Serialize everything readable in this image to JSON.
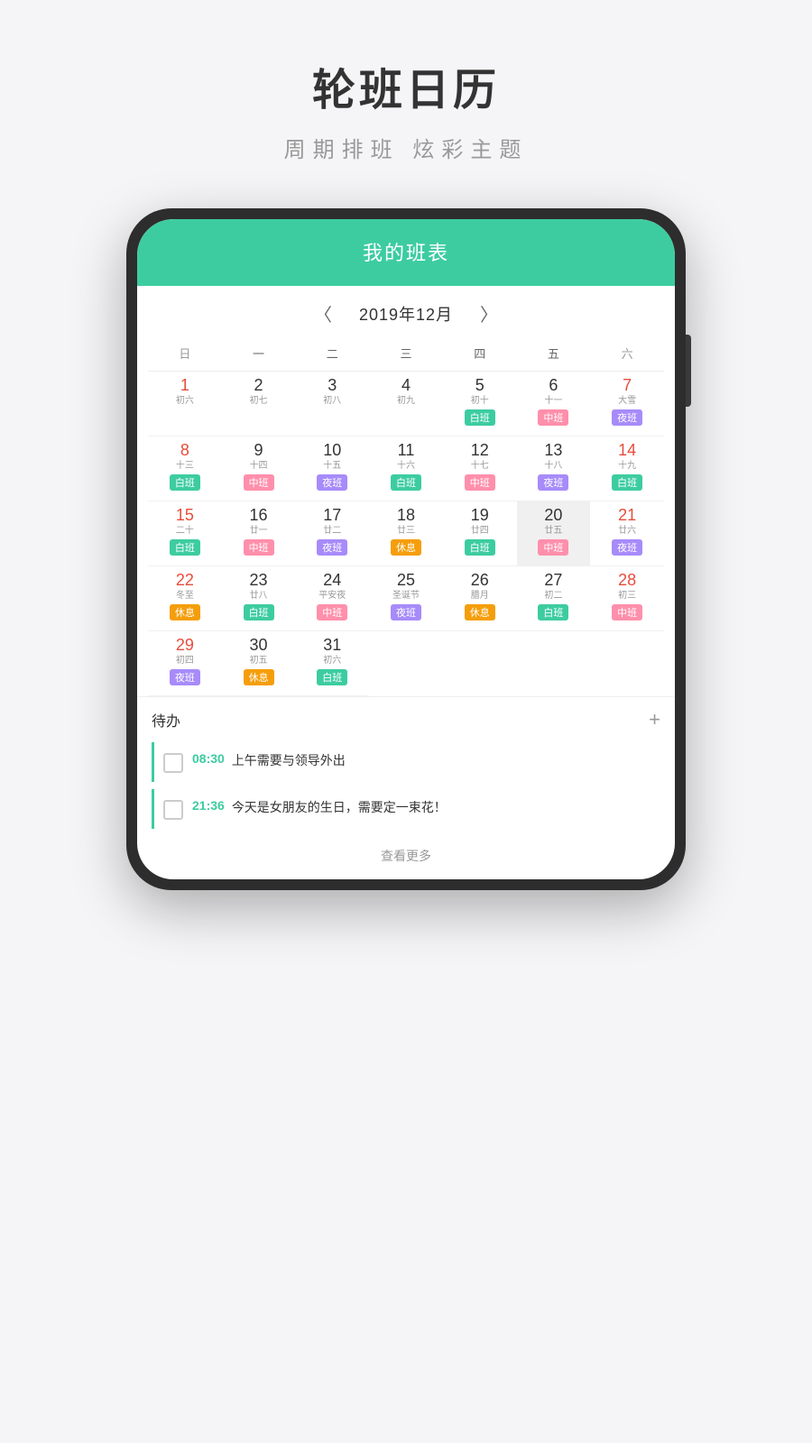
{
  "page": {
    "title": "轮班日历",
    "subtitle": "周期排班  炫彩主题"
  },
  "app": {
    "header_title": "我的班表"
  },
  "calendar": {
    "month_label": "2019年12月",
    "prev_arrow": "〈",
    "next_arrow": "〉",
    "weekdays": [
      "日",
      "一",
      "二",
      "三",
      "四",
      "五",
      "六"
    ],
    "days": [
      {
        "num": "1",
        "lunar": "初六",
        "shift": "",
        "shift_type": "",
        "red": true,
        "green": false,
        "empty": false,
        "today": false
      },
      {
        "num": "2",
        "lunar": "初七",
        "shift": "",
        "shift_type": "",
        "red": false,
        "green": false,
        "empty": false,
        "today": false
      },
      {
        "num": "3",
        "lunar": "初八",
        "shift": "",
        "shift_type": "",
        "red": false,
        "green": false,
        "empty": false,
        "today": false
      },
      {
        "num": "4",
        "lunar": "初九",
        "shift": "",
        "shift_type": "",
        "red": false,
        "green": false,
        "empty": false,
        "today": false
      },
      {
        "num": "5",
        "lunar": "初十",
        "shift": "白班",
        "shift_type": "white",
        "red": false,
        "green": false,
        "empty": false,
        "today": false
      },
      {
        "num": "6",
        "lunar": "十一",
        "shift": "中班",
        "shift_type": "mid",
        "red": false,
        "green": false,
        "empty": false,
        "today": false
      },
      {
        "num": "7",
        "lunar": "大雪",
        "shift": "夜班",
        "shift_type": "night",
        "red": true,
        "green": false,
        "empty": false,
        "today": false
      },
      {
        "num": "8",
        "lunar": "十三",
        "shift": "白班",
        "shift_type": "white",
        "red": true,
        "green": false,
        "empty": false,
        "today": false
      },
      {
        "num": "9",
        "lunar": "十四",
        "shift": "中班",
        "shift_type": "mid",
        "red": false,
        "green": false,
        "empty": false,
        "today": false
      },
      {
        "num": "10",
        "lunar": "十五",
        "shift": "夜班",
        "shift_type": "night",
        "red": false,
        "green": false,
        "empty": false,
        "today": false
      },
      {
        "num": "11",
        "lunar": "十六",
        "shift": "白班",
        "shift_type": "white",
        "red": false,
        "green": false,
        "empty": false,
        "today": false
      },
      {
        "num": "12",
        "lunar": "十七",
        "shift": "中班",
        "shift_type": "mid",
        "red": false,
        "green": false,
        "empty": false,
        "today": false
      },
      {
        "num": "13",
        "lunar": "十八",
        "shift": "夜班",
        "shift_type": "night",
        "red": false,
        "green": false,
        "empty": false,
        "today": false
      },
      {
        "num": "14",
        "lunar": "十九",
        "shift": "白班",
        "shift_type": "white",
        "red": true,
        "green": false,
        "empty": false,
        "today": false
      },
      {
        "num": "15",
        "lunar": "二十",
        "shift": "白班",
        "shift_type": "white",
        "red": true,
        "green": false,
        "empty": false,
        "today": false
      },
      {
        "num": "16",
        "lunar": "廿一",
        "shift": "中班",
        "shift_type": "mid",
        "red": false,
        "green": false,
        "empty": false,
        "today": false
      },
      {
        "num": "17",
        "lunar": "廿二",
        "shift": "夜班",
        "shift_type": "night",
        "red": false,
        "green": false,
        "empty": false,
        "today": false
      },
      {
        "num": "18",
        "lunar": "廿三",
        "shift": "休息",
        "shift_type": "rest",
        "red": false,
        "green": false,
        "empty": false,
        "today": false
      },
      {
        "num": "19",
        "lunar": "廿四",
        "shift": "白班",
        "shift_type": "white",
        "red": false,
        "green": false,
        "empty": false,
        "today": false
      },
      {
        "num": "20",
        "lunar": "廿五",
        "shift": "中班",
        "shift_type": "mid",
        "red": false,
        "green": false,
        "empty": false,
        "today": true
      },
      {
        "num": "21",
        "lunar": "廿六",
        "shift": "夜班",
        "shift_type": "night",
        "red": true,
        "green": false,
        "empty": false,
        "today": false
      },
      {
        "num": "22",
        "lunar": "冬至",
        "shift": "休息",
        "shift_type": "rest",
        "red": true,
        "green": false,
        "empty": false,
        "today": false
      },
      {
        "num": "23",
        "lunar": "廿八",
        "shift": "白班",
        "shift_type": "white",
        "red": false,
        "green": false,
        "empty": false,
        "today": false
      },
      {
        "num": "24",
        "lunar": "平安夜",
        "shift": "中班",
        "shift_type": "mid",
        "red": false,
        "green": false,
        "empty": false,
        "today": false
      },
      {
        "num": "25",
        "lunar": "圣诞节",
        "shift": "夜班",
        "shift_type": "night",
        "red": false,
        "green": false,
        "empty": false,
        "today": false
      },
      {
        "num": "26",
        "lunar": "腊月",
        "shift": "休息",
        "shift_type": "rest",
        "red": false,
        "green": false,
        "empty": false,
        "today": false
      },
      {
        "num": "27",
        "lunar": "初二",
        "shift": "白班",
        "shift_type": "white",
        "red": false,
        "green": false,
        "empty": false,
        "today": false
      },
      {
        "num": "28",
        "lunar": "初三",
        "shift": "中班",
        "shift_type": "mid",
        "red": true,
        "green": false,
        "empty": false,
        "today": false
      },
      {
        "num": "29",
        "lunar": "初四",
        "shift": "夜班",
        "shift_type": "night",
        "red": true,
        "green": false,
        "empty": false,
        "today": false
      },
      {
        "num": "30",
        "lunar": "初五",
        "shift": "休息",
        "shift_type": "rest",
        "red": false,
        "green": false,
        "empty": false,
        "today": false
      },
      {
        "num": "31",
        "lunar": "初六",
        "shift": "白班",
        "shift_type": "white",
        "red": false,
        "green": false,
        "empty": false,
        "today": false
      }
    ]
  },
  "todo": {
    "title": "待办",
    "add_icon": "+",
    "items": [
      {
        "time": "08:30",
        "text": "上午需要与领导外出"
      },
      {
        "time": "21:36",
        "text": "今天是女朋友的生日，需要定一束花！"
      }
    ],
    "more_label": "查看更多"
  }
}
